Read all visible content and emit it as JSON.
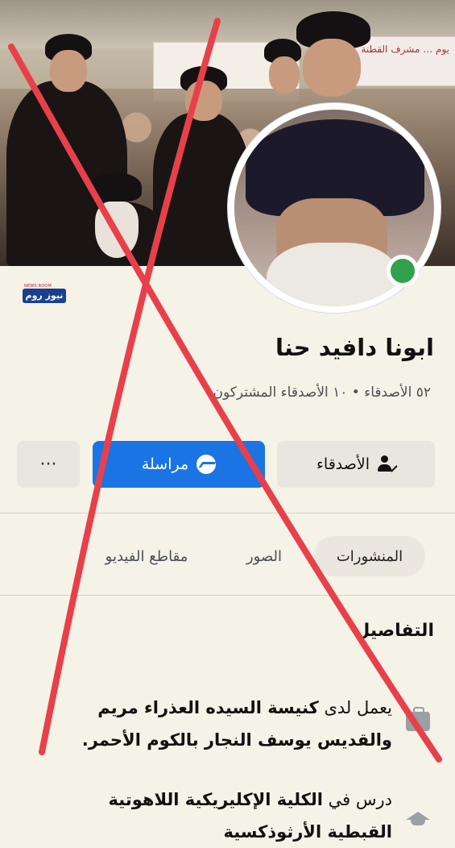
{
  "watermark": {
    "tag": "NEWS ROOM",
    "logo": "نيوز روم"
  },
  "cover": {
    "banner_text": "يوم … مشرف القطنة"
  },
  "profile": {
    "name": "ابونا دافيد حنا",
    "friends_line": "٥٢ الأصدقاء • ١٠ الأصدقاء المشتركون",
    "online": true
  },
  "actions": {
    "friends_label": "الأصدقاء",
    "message_label": "مراسلة",
    "more_label": "···"
  },
  "tabs": [
    {
      "label": "المنشورات",
      "active": true
    },
    {
      "label": "الصور",
      "active": false
    },
    {
      "label": "مقاطع الفيديو",
      "active": false
    }
  ],
  "details": {
    "title": "التفاصيل",
    "items": [
      {
        "icon": "briefcase-icon",
        "prefix": "يعمل لدى",
        "text": "كنيسة السيده العذراء مريم والقديس يوسف النجار بالكوم الأحمر."
      },
      {
        "icon": "graduation-cap-icon",
        "prefix": "درس في",
        "text": "الكلية الإكليريكية اللاهوتية القبطية الأرثوذكسية"
      }
    ]
  },
  "colors": {
    "accent": "#1b74e4",
    "online": "#31a24c",
    "cross": "#e8404a",
    "background": "#f5f2e7"
  }
}
